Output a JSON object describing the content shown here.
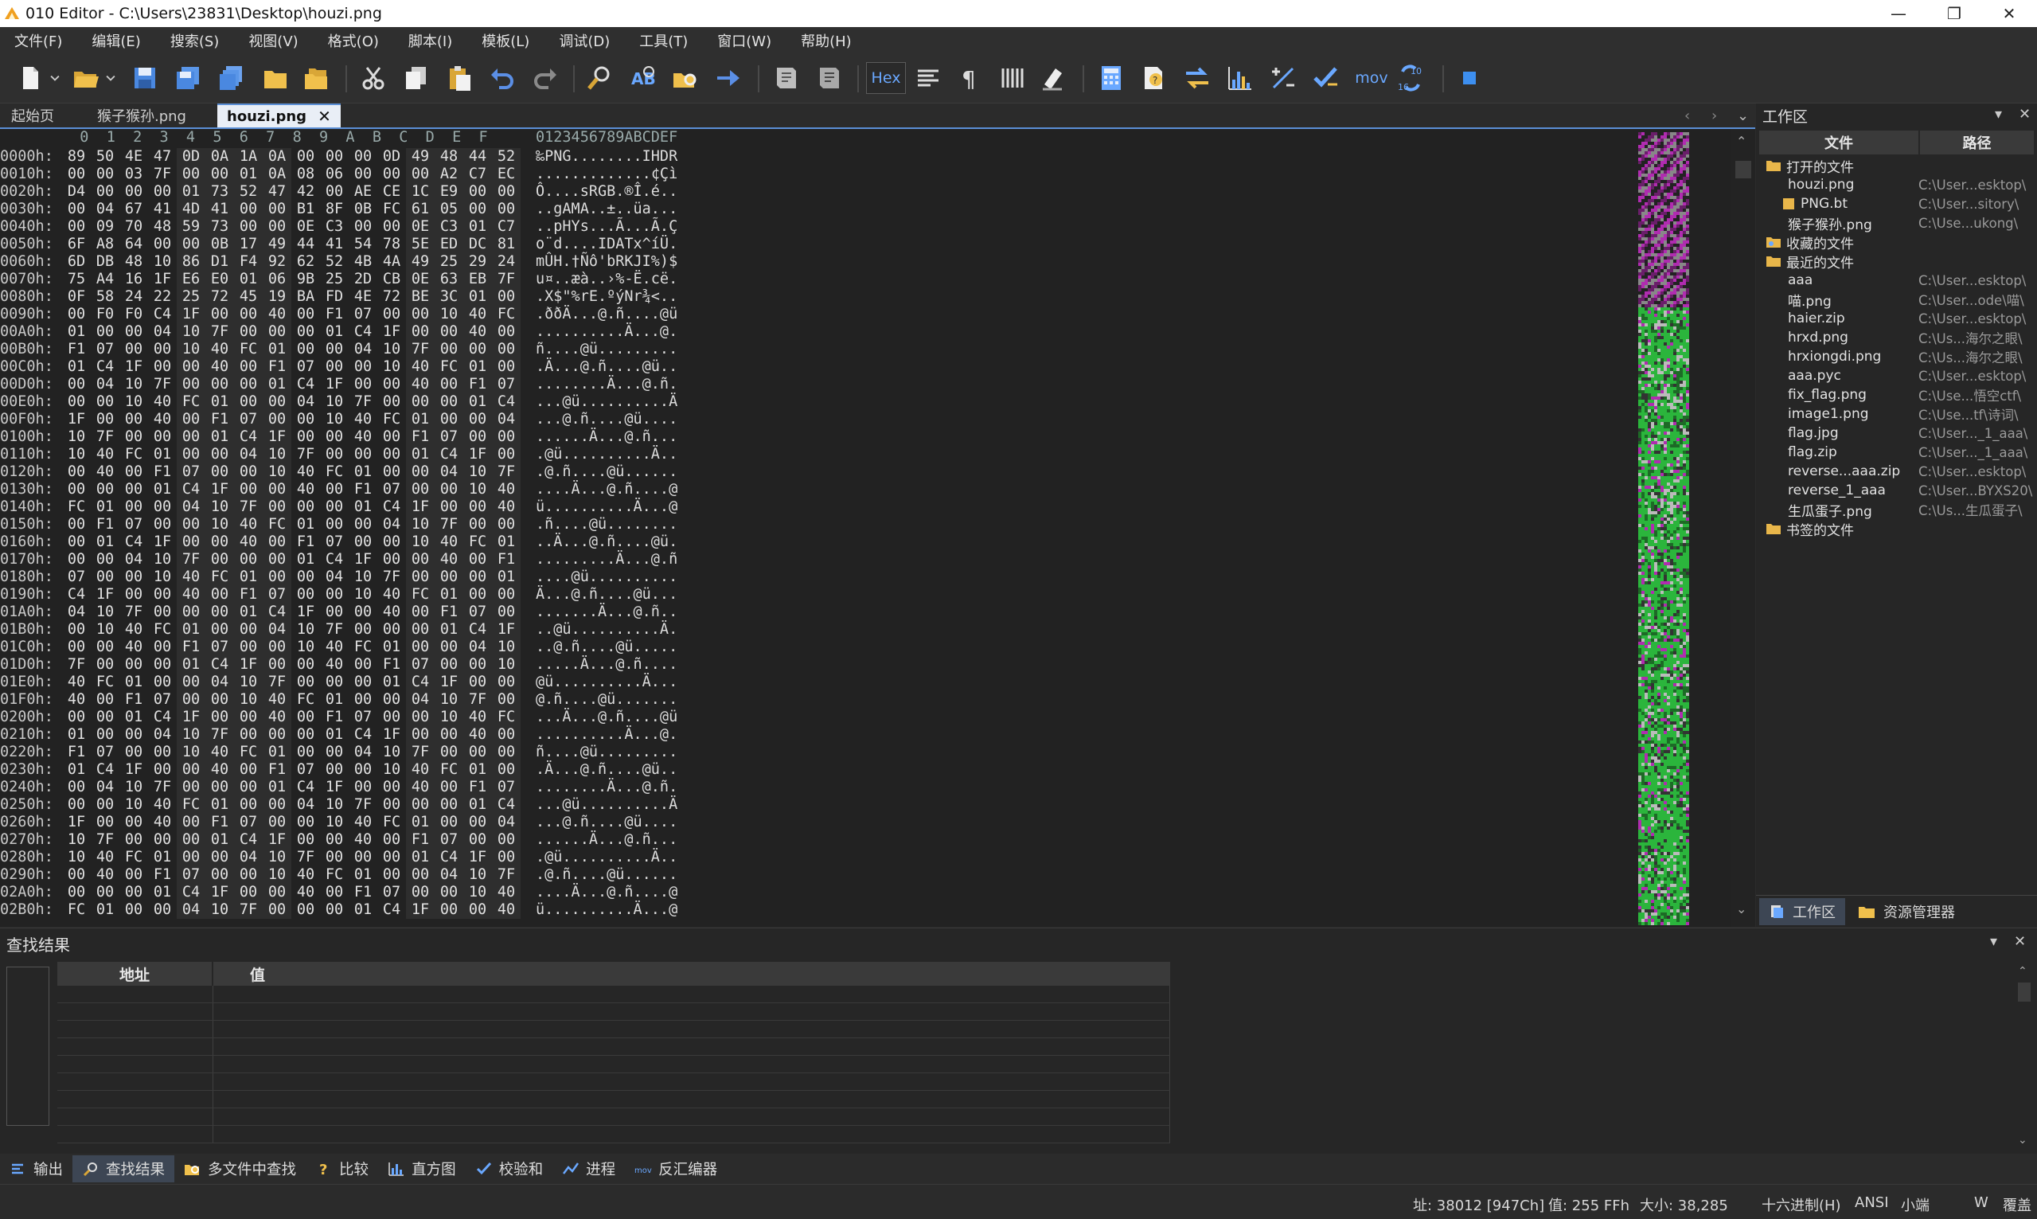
{
  "window": {
    "title": "010 Editor - C:\\Users\\23831\\Desktop\\houzi.png",
    "minimize": "—",
    "maximize": "❐",
    "close": "✕"
  },
  "menu": [
    "文件(F)",
    "编辑(E)",
    "搜索(S)",
    "视图(V)",
    "格式(O)",
    "脚本(I)",
    "模板(L)",
    "调试(D)",
    "工具(T)",
    "窗口(W)",
    "帮助(H)"
  ],
  "toolbar": {
    "hex_label": "Hex",
    "mov_label": "mov",
    "base_label_top": "10",
    "base_label_bottom": "16"
  },
  "tabs": [
    {
      "label": "起始页",
      "active": false
    },
    {
      "label": "猴子猴孙.png",
      "active": false
    },
    {
      "label": "houzi.png",
      "active": true
    }
  ],
  "tab_close": "✕",
  "editor": {
    "column_ruler": "  0  1  2  3  4  5  6  7  8  9  A  B  C  D  E  F",
    "ascii_ruler": "0123456789ABCDEF",
    "rows": [
      {
        "addr": "0000h:",
        "hex": [
          "89",
          "50",
          "4E",
          "47",
          "0D",
          "0A",
          "1A",
          "0A",
          "00",
          "00",
          "00",
          "0D",
          "49",
          "48",
          "44",
          "52"
        ],
        "ascii": "‰PNG........IHDR"
      },
      {
        "addr": "0010h:",
        "hex": [
          "00",
          "00",
          "03",
          "7F",
          "00",
          "00",
          "01",
          "0A",
          "08",
          "06",
          "00",
          "00",
          "00",
          "A2",
          "C7",
          "EC"
        ],
        "ascii": ".............¢Çì"
      },
      {
        "addr": "0020h:",
        "hex": [
          "D4",
          "00",
          "00",
          "00",
          "01",
          "73",
          "52",
          "47",
          "42",
          "00",
          "AE",
          "CE",
          "1C",
          "E9",
          "00",
          "00"
        ],
        "ascii": "Ô....sRGB.®Î.é.."
      },
      {
        "addr": "0030h:",
        "hex": [
          "00",
          "04",
          "67",
          "41",
          "4D",
          "41",
          "00",
          "00",
          "B1",
          "8F",
          "0B",
          "FC",
          "61",
          "05",
          "00",
          "00"
        ],
        "ascii": "..gAMA..±..üa..."
      },
      {
        "addr": "0040h:",
        "hex": [
          "00",
          "09",
          "70",
          "48",
          "59",
          "73",
          "00",
          "00",
          "0E",
          "C3",
          "00",
          "00",
          "0E",
          "C3",
          "01",
          "C7"
        ],
        "ascii": "..pHYs...Ã...Ã.Ç"
      },
      {
        "addr": "0050h:",
        "hex": [
          "6F",
          "A8",
          "64",
          "00",
          "00",
          "0B",
          "17",
          "49",
          "44",
          "41",
          "54",
          "78",
          "5E",
          "ED",
          "DC",
          "81"
        ],
        "ascii": "o¨d....IDATx^íÜ."
      },
      {
        "addr": "0060h:",
        "hex": [
          "6D",
          "DB",
          "48",
          "10",
          "86",
          "D1",
          "F4",
          "92",
          "62",
          "52",
          "4B",
          "4A",
          "49",
          "25",
          "29",
          "24"
        ],
        "ascii": "mÛH.†Ñô'bRKJI%)$"
      },
      {
        "addr": "0070h:",
        "hex": [
          "75",
          "A4",
          "16",
          "1F",
          "E6",
          "E0",
          "01",
          "06",
          "9B",
          "25",
          "2D",
          "CB",
          "0E",
          "63",
          "EB",
          "7F"
        ],
        "ascii": "u¤..æà..›%-Ë.cë."
      },
      {
        "addr": "0080h:",
        "hex": [
          "0F",
          "58",
          "24",
          "22",
          "25",
          "72",
          "45",
          "19",
          "BA",
          "FD",
          "4E",
          "72",
          "BE",
          "3C",
          "01",
          "00"
        ],
        "ascii": ".X$\"%rE.ºýNr¾<.."
      },
      {
        "addr": "0090h:",
        "hex": [
          "00",
          "F0",
          "F0",
          "C4",
          "1F",
          "00",
          "00",
          "40",
          "00",
          "F1",
          "07",
          "00",
          "00",
          "10",
          "40",
          "FC"
        ],
        "ascii": ".ððÄ...@.ñ....@ü"
      },
      {
        "addr": "00A0h:",
        "hex": [
          "01",
          "00",
          "00",
          "04",
          "10",
          "7F",
          "00",
          "00",
          "00",
          "01",
          "C4",
          "1F",
          "00",
          "00",
          "40",
          "00"
        ],
        "ascii": "..........Ä...@."
      },
      {
        "addr": "00B0h:",
        "hex": [
          "F1",
          "07",
          "00",
          "00",
          "10",
          "40",
          "FC",
          "01",
          "00",
          "00",
          "04",
          "10",
          "7F",
          "00",
          "00",
          "00"
        ],
        "ascii": "ñ....@ü........."
      },
      {
        "addr": "00C0h:",
        "hex": [
          "01",
          "C4",
          "1F",
          "00",
          "00",
          "40",
          "00",
          "F1",
          "07",
          "00",
          "00",
          "10",
          "40",
          "FC",
          "01",
          "00"
        ],
        "ascii": ".Ä...@.ñ....@ü.."
      },
      {
        "addr": "00D0h:",
        "hex": [
          "00",
          "04",
          "10",
          "7F",
          "00",
          "00",
          "00",
          "01",
          "C4",
          "1F",
          "00",
          "00",
          "40",
          "00",
          "F1",
          "07"
        ],
        "ascii": "........Ä...@.ñ."
      },
      {
        "addr": "00E0h:",
        "hex": [
          "00",
          "00",
          "10",
          "40",
          "FC",
          "01",
          "00",
          "00",
          "04",
          "10",
          "7F",
          "00",
          "00",
          "00",
          "01",
          "C4"
        ],
        "ascii": "...@ü..........Ä"
      },
      {
        "addr": "00F0h:",
        "hex": [
          "1F",
          "00",
          "00",
          "40",
          "00",
          "F1",
          "07",
          "00",
          "00",
          "10",
          "40",
          "FC",
          "01",
          "00",
          "00",
          "04"
        ],
        "ascii": "...@.ñ....@ü...."
      },
      {
        "addr": "0100h:",
        "hex": [
          "10",
          "7F",
          "00",
          "00",
          "00",
          "01",
          "C4",
          "1F",
          "00",
          "00",
          "40",
          "00",
          "F1",
          "07",
          "00",
          "00"
        ],
        "ascii": "......Ä...@.ñ..."
      },
      {
        "addr": "0110h:",
        "hex": [
          "10",
          "40",
          "FC",
          "01",
          "00",
          "00",
          "04",
          "10",
          "7F",
          "00",
          "00",
          "00",
          "01",
          "C4",
          "1F",
          "00"
        ],
        "ascii": ".@ü..........Ä.."
      },
      {
        "addr": "0120h:",
        "hex": [
          "00",
          "40",
          "00",
          "F1",
          "07",
          "00",
          "00",
          "10",
          "40",
          "FC",
          "01",
          "00",
          "00",
          "04",
          "10",
          "7F"
        ],
        "ascii": ".@.ñ....@ü......"
      },
      {
        "addr": "0130h:",
        "hex": [
          "00",
          "00",
          "00",
          "01",
          "C4",
          "1F",
          "00",
          "00",
          "40",
          "00",
          "F1",
          "07",
          "00",
          "00",
          "10",
          "40"
        ],
        "ascii": "....Ä...@.ñ....@"
      },
      {
        "addr": "0140h:",
        "hex": [
          "FC",
          "01",
          "00",
          "00",
          "04",
          "10",
          "7F",
          "00",
          "00",
          "00",
          "01",
          "C4",
          "1F",
          "00",
          "00",
          "40"
        ],
        "ascii": "ü..........Ä...@"
      },
      {
        "addr": "0150h:",
        "hex": [
          "00",
          "F1",
          "07",
          "00",
          "00",
          "10",
          "40",
          "FC",
          "01",
          "00",
          "00",
          "04",
          "10",
          "7F",
          "00",
          "00"
        ],
        "ascii": ".ñ....@ü........"
      },
      {
        "addr": "0160h:",
        "hex": [
          "00",
          "01",
          "C4",
          "1F",
          "00",
          "00",
          "40",
          "00",
          "F1",
          "07",
          "00",
          "00",
          "10",
          "40",
          "FC",
          "01"
        ],
        "ascii": "..Ä...@.ñ....@ü."
      },
      {
        "addr": "0170h:",
        "hex": [
          "00",
          "00",
          "04",
          "10",
          "7F",
          "00",
          "00",
          "00",
          "01",
          "C4",
          "1F",
          "00",
          "00",
          "40",
          "00",
          "F1"
        ],
        "ascii": ".........Ä...@.ñ"
      },
      {
        "addr": "0180h:",
        "hex": [
          "07",
          "00",
          "00",
          "10",
          "40",
          "FC",
          "01",
          "00",
          "00",
          "04",
          "10",
          "7F",
          "00",
          "00",
          "00",
          "01"
        ],
        "ascii": "....@ü.........."
      },
      {
        "addr": "0190h:",
        "hex": [
          "C4",
          "1F",
          "00",
          "00",
          "40",
          "00",
          "F1",
          "07",
          "00",
          "00",
          "10",
          "40",
          "FC",
          "01",
          "00",
          "00"
        ],
        "ascii": "Ä...@.ñ....@ü..."
      },
      {
        "addr": "01A0h:",
        "hex": [
          "04",
          "10",
          "7F",
          "00",
          "00",
          "00",
          "01",
          "C4",
          "1F",
          "00",
          "00",
          "40",
          "00",
          "F1",
          "07",
          "00"
        ],
        "ascii": ".......Ä...@.ñ.."
      },
      {
        "addr": "01B0h:",
        "hex": [
          "00",
          "10",
          "40",
          "FC",
          "01",
          "00",
          "00",
          "04",
          "10",
          "7F",
          "00",
          "00",
          "00",
          "01",
          "C4",
          "1F"
        ],
        "ascii": "..@ü..........Ä."
      },
      {
        "addr": "01C0h:",
        "hex": [
          "00",
          "00",
          "40",
          "00",
          "F1",
          "07",
          "00",
          "00",
          "10",
          "40",
          "FC",
          "01",
          "00",
          "00",
          "04",
          "10"
        ],
        "ascii": "..@.ñ....@ü....."
      },
      {
        "addr": "01D0h:",
        "hex": [
          "7F",
          "00",
          "00",
          "00",
          "01",
          "C4",
          "1F",
          "00",
          "00",
          "40",
          "00",
          "F1",
          "07",
          "00",
          "00",
          "10"
        ],
        "ascii": ".....Ä...@.ñ...."
      },
      {
        "addr": "01E0h:",
        "hex": [
          "40",
          "FC",
          "01",
          "00",
          "00",
          "04",
          "10",
          "7F",
          "00",
          "00",
          "00",
          "01",
          "C4",
          "1F",
          "00",
          "00"
        ],
        "ascii": "@ü..........Ä..."
      },
      {
        "addr": "01F0h:",
        "hex": [
          "40",
          "00",
          "F1",
          "07",
          "00",
          "00",
          "10",
          "40",
          "FC",
          "01",
          "00",
          "00",
          "04",
          "10",
          "7F",
          "00"
        ],
        "ascii": "@.ñ....@ü......."
      },
      {
        "addr": "0200h:",
        "hex": [
          "00",
          "00",
          "01",
          "C4",
          "1F",
          "00",
          "00",
          "40",
          "00",
          "F1",
          "07",
          "00",
          "00",
          "10",
          "40",
          "FC"
        ],
        "ascii": "...Ä...@.ñ....@ü"
      },
      {
        "addr": "0210h:",
        "hex": [
          "01",
          "00",
          "00",
          "04",
          "10",
          "7F",
          "00",
          "00",
          "00",
          "01",
          "C4",
          "1F",
          "00",
          "00",
          "40",
          "00"
        ],
        "ascii": "..........Ä...@."
      },
      {
        "addr": "0220h:",
        "hex": [
          "F1",
          "07",
          "00",
          "00",
          "10",
          "40",
          "FC",
          "01",
          "00",
          "00",
          "04",
          "10",
          "7F",
          "00",
          "00",
          "00"
        ],
        "ascii": "ñ....@ü........."
      },
      {
        "addr": "0230h:",
        "hex": [
          "01",
          "C4",
          "1F",
          "00",
          "00",
          "40",
          "00",
          "F1",
          "07",
          "00",
          "00",
          "10",
          "40",
          "FC",
          "01",
          "00"
        ],
        "ascii": ".Ä...@.ñ....@ü.."
      },
      {
        "addr": "0240h:",
        "hex": [
          "00",
          "04",
          "10",
          "7F",
          "00",
          "00",
          "00",
          "01",
          "C4",
          "1F",
          "00",
          "00",
          "40",
          "00",
          "F1",
          "07"
        ],
        "ascii": "........Ä...@.ñ."
      },
      {
        "addr": "0250h:",
        "hex": [
          "00",
          "00",
          "10",
          "40",
          "FC",
          "01",
          "00",
          "00",
          "04",
          "10",
          "7F",
          "00",
          "00",
          "00",
          "01",
          "C4"
        ],
        "ascii": "...@ü..........Ä"
      },
      {
        "addr": "0260h:",
        "hex": [
          "1F",
          "00",
          "00",
          "40",
          "00",
          "F1",
          "07",
          "00",
          "00",
          "10",
          "40",
          "FC",
          "01",
          "00",
          "00",
          "04"
        ],
        "ascii": "...@.ñ....@ü...."
      },
      {
        "addr": "0270h:",
        "hex": [
          "10",
          "7F",
          "00",
          "00",
          "00",
          "01",
          "C4",
          "1F",
          "00",
          "00",
          "40",
          "00",
          "F1",
          "07",
          "00",
          "00"
        ],
        "ascii": "......Ä...@.ñ..."
      },
      {
        "addr": "0280h:",
        "hex": [
          "10",
          "40",
          "FC",
          "01",
          "00",
          "00",
          "04",
          "10",
          "7F",
          "00",
          "00",
          "00",
          "01",
          "C4",
          "1F",
          "00"
        ],
        "ascii": ".@ü..........Ä.."
      },
      {
        "addr": "0290h:",
        "hex": [
          "00",
          "40",
          "00",
          "F1",
          "07",
          "00",
          "00",
          "10",
          "40",
          "FC",
          "01",
          "00",
          "00",
          "04",
          "10",
          "7F"
        ],
        "ascii": ".@.ñ....@ü......"
      },
      {
        "addr": "02A0h:",
        "hex": [
          "00",
          "00",
          "00",
          "01",
          "C4",
          "1F",
          "00",
          "00",
          "40",
          "00",
          "F1",
          "07",
          "00",
          "00",
          "10",
          "40"
        ],
        "ascii": "....Ä...@.ñ....@"
      },
      {
        "addr": "02B0h:",
        "hex": [
          "FC",
          "01",
          "00",
          "00",
          "04",
          "10",
          "7F",
          "00",
          "00",
          "00",
          "01",
          "C4",
          "1F",
          "00",
          "00",
          "40"
        ],
        "ascii": "ü..........Ä...@"
      }
    ]
  },
  "workspace": {
    "title": "工作区",
    "col_file": "文件",
    "col_path": "路径",
    "sections": [
      {
        "label": "打开的文件",
        "kind": "open",
        "items": [
          {
            "name": "houzi.png",
            "path": "C:\\User...esktop\\"
          },
          {
            "name": "PNG.bt",
            "path": "C:\\User...sitory\\"
          },
          {
            "name": "猴子猴孙.png",
            "path": "C:\\Use...ukong\\"
          }
        ]
      },
      {
        "label": "收藏的文件",
        "kind": "fav",
        "items": []
      },
      {
        "label": "最近的文件",
        "kind": "recent",
        "items": [
          {
            "name": "aaa",
            "path": "C:\\User...esktop\\"
          },
          {
            "name": "喵.png",
            "path": "C:\\User...ode\\喵\\"
          },
          {
            "name": "haier.zip",
            "path": "C:\\User...esktop\\"
          },
          {
            "name": "hrxd.png",
            "path": "C:\\Us...海尔之眼\\"
          },
          {
            "name": "hrxiongdi.png",
            "path": "C:\\Us...海尔之眼\\"
          },
          {
            "name": "aaa.pyc",
            "path": "C:\\User...esktop\\"
          },
          {
            "name": "fix_flag.png",
            "path": "C:\\Use...悟空ctf\\"
          },
          {
            "name": "image1.png",
            "path": "C:\\Use...tf\\诗词\\"
          },
          {
            "name": "flag.jpg",
            "path": "C:\\User..._1_aaa\\"
          },
          {
            "name": "flag.zip",
            "path": "C:\\User..._1_aaa\\"
          },
          {
            "name": "reverse...aaa.zip",
            "path": "C:\\User...esktop\\"
          },
          {
            "name": "reverse_1_aaa",
            "path": "C:\\User...BYXS20\\"
          },
          {
            "name": "生瓜蛋子.png",
            "path": "C:\\Us...生瓜蛋子\\"
          }
        ]
      },
      {
        "label": "书签的文件",
        "kind": "bookmark",
        "items": []
      }
    ],
    "bottom_tabs": [
      "工作区",
      "资源管理器"
    ]
  },
  "find_panel": {
    "title": "查找结果",
    "col_addr": "地址",
    "col_value": "值"
  },
  "bottom_tabs": [
    "输出",
    "查找结果",
    "多文件中查找",
    "比较",
    "直方图",
    "校验和",
    "进程",
    "反汇编器"
  ],
  "bottom_active": "查找结果",
  "status": {
    "address": "址: 38012 [947Ch]",
    "value": "值: 255 FFh",
    "size": "大小: 38,285",
    "mode": "十六进制(H)",
    "encoding": "ANSI",
    "endian": "小端",
    "w": "W",
    "overwrite": "覆盖"
  },
  "colors": {
    "accent": "#5b8fd6",
    "toolbar_icon": "#6aa8ff",
    "folder": "#e8b64a",
    "strip_green": "#2bb53c",
    "strip_magenta": "#b02cb0"
  }
}
